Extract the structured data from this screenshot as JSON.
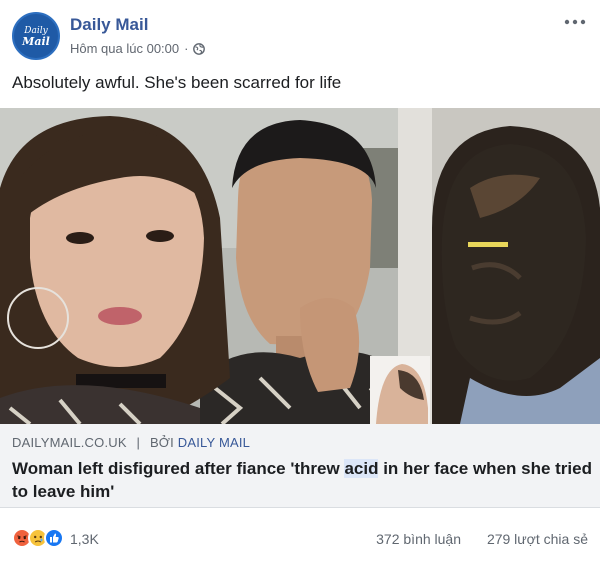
{
  "header": {
    "page_name": "Daily Mail",
    "avatar_line1": "Daily",
    "avatar_line2": "Mail",
    "timestamp": "Hôm qua lúc 00:00",
    "dot": "·",
    "privacy_icon": "globe-icon",
    "more_icon": "more-options-icon"
  },
  "caption": "Absolutely awful. She's been scarred for life",
  "link": {
    "domain": "DAILYMAIL.CO.UK",
    "separator": "|",
    "by_label": "BỞI",
    "by_name": "DAILY MAIL",
    "title_before": "Woman left disfigured after fiance 'threw ",
    "title_highlight": "acid",
    "title_after": " in her face when she tried to leave him'"
  },
  "footer": {
    "reactions": [
      "angry-reaction-icon",
      "sad-reaction-icon",
      "like-reaction-icon"
    ],
    "reaction_count": "1,3K",
    "comments": "372 bình luận",
    "shares": "279 lượt chia sẻ"
  },
  "colors": {
    "page_name": "#385898",
    "link_box_bg": "#f2f3f5",
    "muted_text": "#606770"
  }
}
